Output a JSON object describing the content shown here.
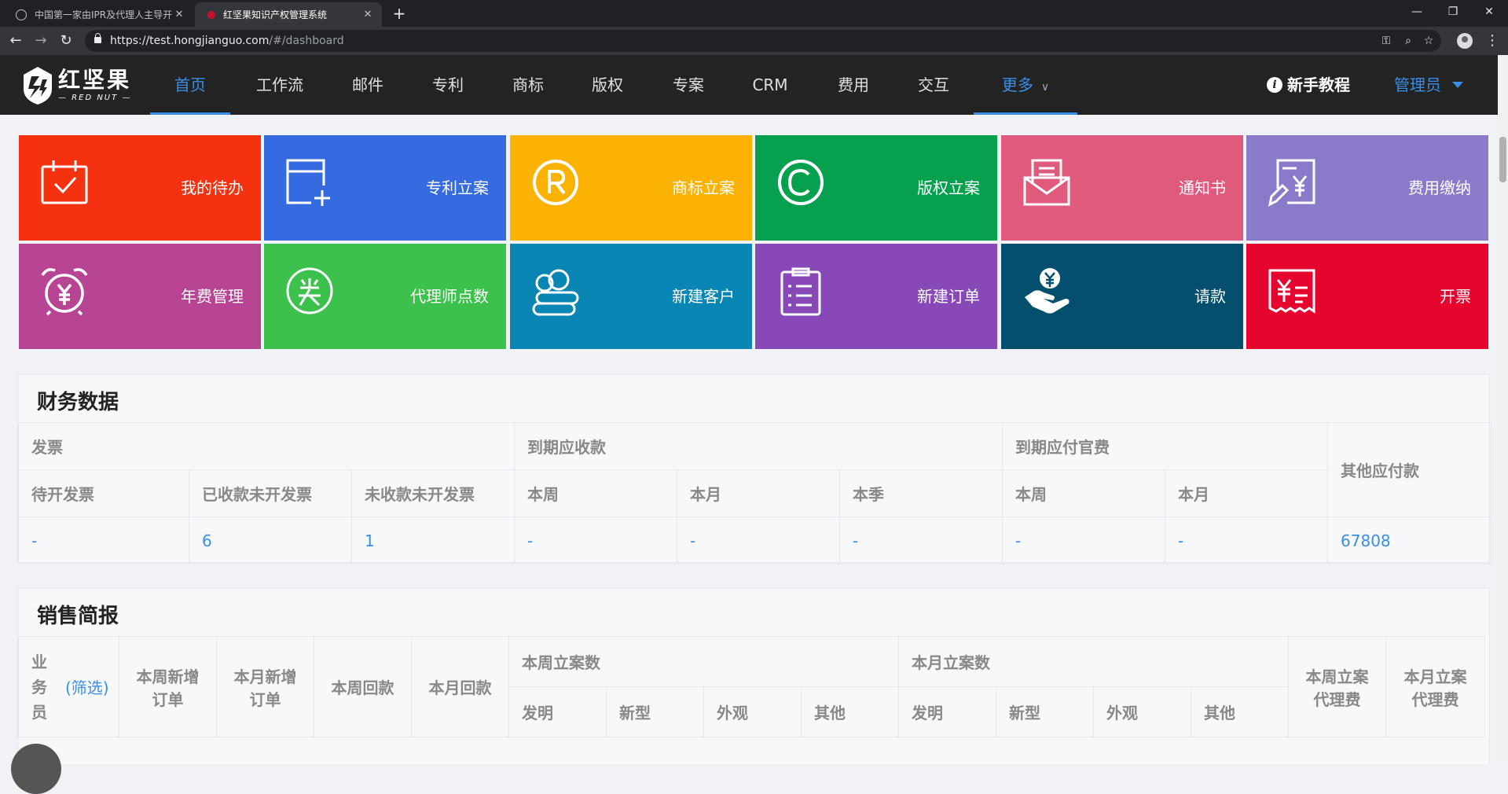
{
  "browser": {
    "tabs": [
      {
        "title": "中国第一家由IPR及代理人主导开",
        "close": "✕"
      },
      {
        "title": "红坚果知识产权管理系统",
        "close": "✕"
      }
    ],
    "new_tab": "+",
    "url_host": "https://test.hongjianguo.com",
    "url_path": "/#/dashboard",
    "window_controls": {
      "minimize": "—",
      "restore": "❐",
      "close": "✕"
    }
  },
  "header": {
    "logo_cn": "红坚果",
    "logo_en": "— RED NUT —",
    "nav": [
      "首页",
      "工作流",
      "邮件",
      "专利",
      "商标",
      "版权",
      "专案",
      "CRM",
      "费用",
      "交互",
      "更多"
    ],
    "active_nav": "首页",
    "tutorial": "新手教程",
    "user": "管理员"
  },
  "tiles": [
    {
      "label": "我的待办",
      "color": "#f5320f",
      "icon": "calendar-check-icon"
    },
    {
      "label": "专利立案",
      "color": "#356bde",
      "icon": "add-window-icon"
    },
    {
      "label": "商标立案",
      "color": "#fbb202",
      "icon": "registered-icon"
    },
    {
      "label": "版权立案",
      "color": "#07a04f",
      "icon": "copyright-icon"
    },
    {
      "label": "通知书",
      "color": "#e05a7d",
      "icon": "envelope-letter-icon"
    },
    {
      "label": "费用缴纳",
      "color": "#8b79c9",
      "icon": "payment-bill-icon"
    },
    {
      "label": "年费管理",
      "color": "#b84594",
      "icon": "alarm-yen-icon"
    },
    {
      "label": "代理师点数",
      "color": "#3cc24c",
      "icon": "award-icon"
    },
    {
      "label": "新建客户",
      "color": "#0a86b4",
      "icon": "customers-icon"
    },
    {
      "label": "新建订单",
      "color": "#8849b8",
      "icon": "order-list-icon"
    },
    {
      "label": "请款",
      "color": "#054f6e",
      "icon": "hand-yen-icon"
    },
    {
      "label": "开票",
      "color": "#e5052f",
      "icon": "invoice-icon"
    }
  ],
  "finance": {
    "title": "财务数据",
    "groups": {
      "invoice": "发票",
      "receivable": "到期应收款",
      "official_fee": "到期应付官费",
      "other": "其他应付款"
    },
    "columns": [
      "待开发票",
      "已收款未开发票",
      "未收款未开发票",
      "本周",
      "本月",
      "本季",
      "本周",
      "本月"
    ],
    "values": [
      "-",
      "6",
      "1",
      "-",
      "-",
      "-",
      "-",
      "-",
      "67808"
    ]
  },
  "sales": {
    "title": "销售简报",
    "salesperson": "业务员",
    "filter": "(筛选)",
    "columns": {
      "week_orders": "本周新增订单",
      "month_orders": "本月新增订单",
      "week_payment": "本周回款",
      "month_payment": "本月回款",
      "week_cases": "本周立案数",
      "month_cases": "本月立案数",
      "week_fee": "本周立案代理费",
      "month_fee": "本月立案代理费"
    },
    "case_types": [
      "发明",
      "新型",
      "外观",
      "其他"
    ]
  }
}
